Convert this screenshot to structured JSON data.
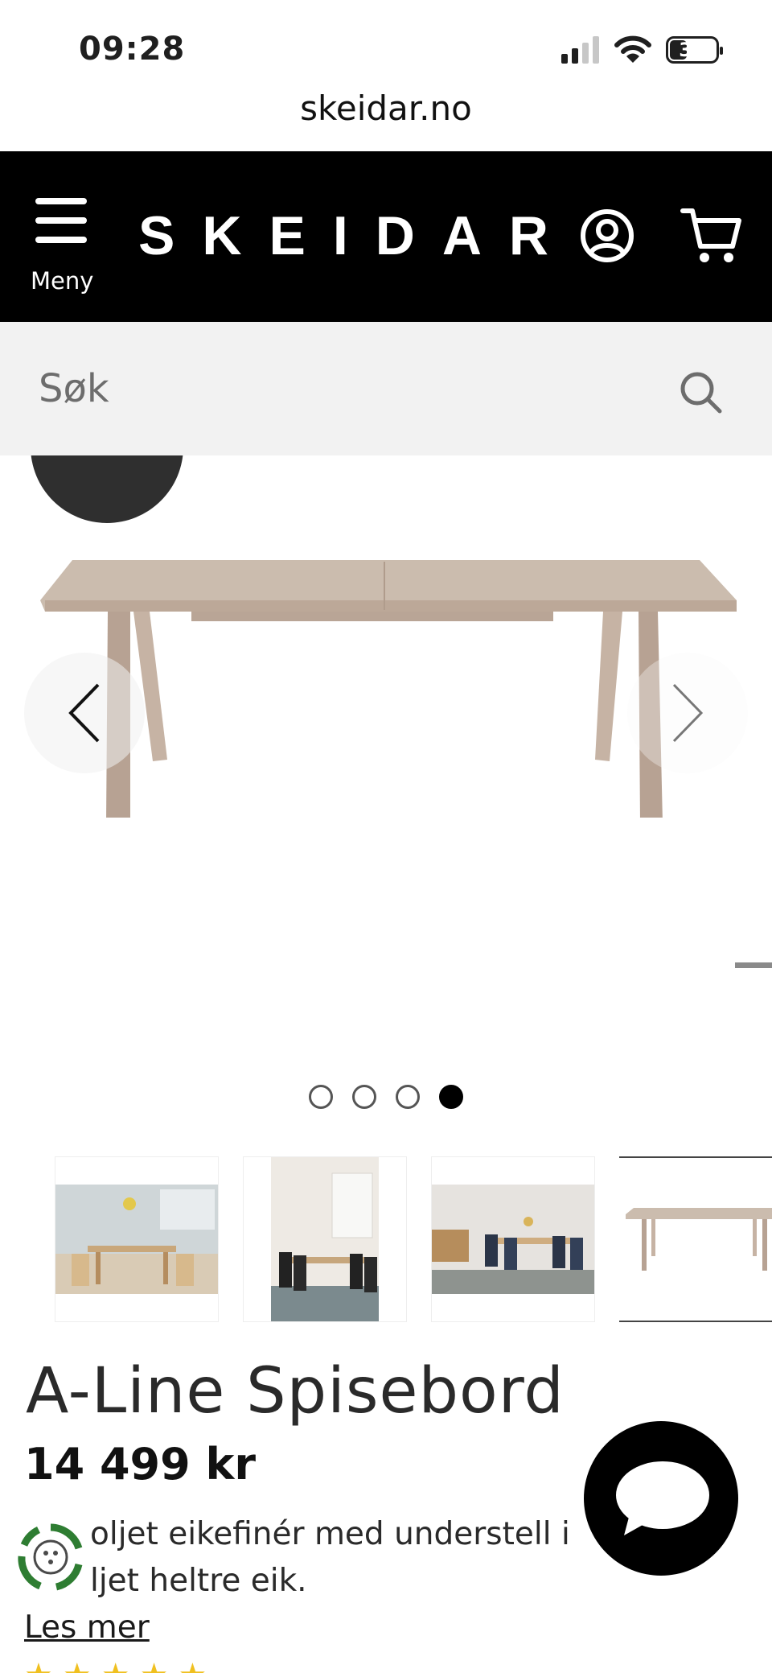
{
  "status_bar": {
    "time": "09:28",
    "battery": "37",
    "battery_level": 0.37
  },
  "browser": {
    "url": "skeidar.no"
  },
  "header": {
    "menu_label": "Meny",
    "logo": "SKEIDAR",
    "icons": [
      "menu-icon",
      "account-icon",
      "cart-icon"
    ]
  },
  "search": {
    "placeholder": "Søk"
  },
  "gallery": {
    "dots_count": 4,
    "active_index": 3,
    "thumbnails": [
      "dining-room-scene-1",
      "dining-room-scene-2",
      "dining-room-scene-3",
      "table-product-shot"
    ]
  },
  "product": {
    "title": "A-Line Spisebord",
    "price": "14 499 kr",
    "description_line1": "oljet eikefinér med understell i",
    "description_line2": "ljet heltre eik.",
    "read_more": "Les mer"
  },
  "colors": {
    "header_bg": "#000000",
    "search_bg": "#f2f2f2",
    "table_wood": "#c9b7a8",
    "eco_green": "#2e7d32",
    "star": "#f0c020"
  }
}
